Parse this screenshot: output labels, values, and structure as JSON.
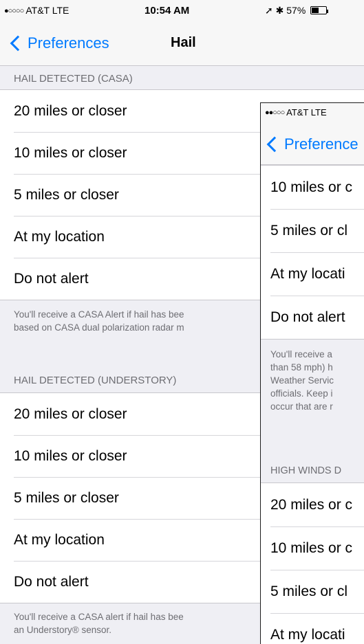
{
  "screen_a": {
    "status_bar": {
      "signal_dots": "●○○○○",
      "carrier": "AT&T  LTE",
      "time": "10:54 AM",
      "icons": "➚ ✱ 57%",
      "battery_level": 0.57
    },
    "nav": {
      "back_label": "Preferences",
      "title": "Hail"
    },
    "sections": [
      {
        "header": "HAIL DETECTED (CASA)",
        "options": [
          "20 miles or closer",
          "10 miles or closer",
          "5 miles or closer",
          "At my location",
          "Do not alert"
        ],
        "footer_lines": [
          "You'll receive a CASA Alert if hail has bee",
          "based on CASA dual polarization radar m"
        ]
      },
      {
        "header": "HAIL DETECTED (UNDERSTORY)",
        "options": [
          "20 miles or closer",
          "10 miles or closer",
          "5 miles or closer",
          "At my location",
          "Do not alert"
        ],
        "footer_lines": [
          "You'll receive a CASA alert if hail has bee",
          "an Understory® sensor."
        ]
      }
    ]
  },
  "screen_b": {
    "status_bar": {
      "signal_dots": "●●○○○",
      "carrier": "AT&T  LTE"
    },
    "nav": {
      "back_label": "Preference"
    },
    "group1_options": [
      "10 miles or c",
      "5 miles or cl",
      "At my locati",
      "Do not alert"
    ],
    "footer_lines": [
      "You'll receive a",
      "than 58 mph) h",
      "Weather Servic",
      "officials. Keep i",
      "occur that are r"
    ],
    "section2_header": "HIGH WINDS D",
    "group2_options": [
      "20 miles or c",
      "10 miles or c",
      "5 miles or cl",
      "At my locati"
    ]
  }
}
